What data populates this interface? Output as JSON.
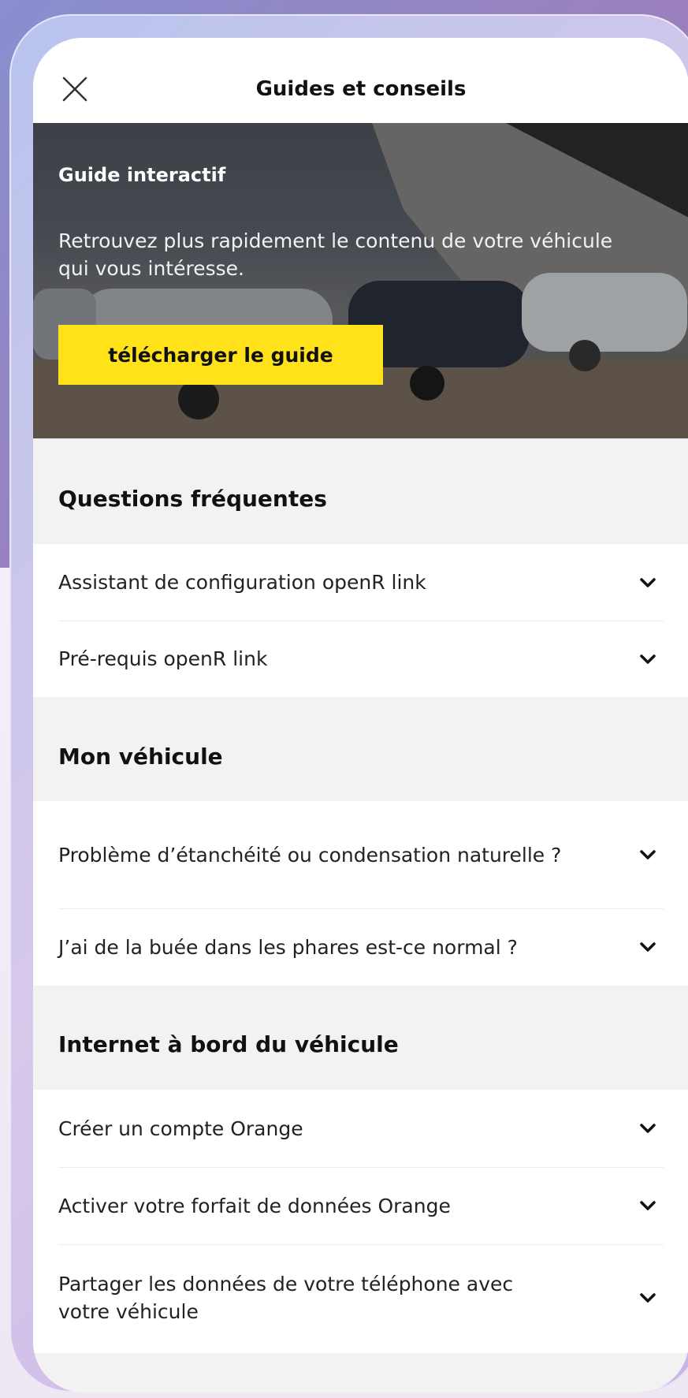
{
  "header": {
    "title": "Guides et conseils"
  },
  "hero": {
    "title": "Guide interactif",
    "description": "Retrouvez plus rapidement le contenu de votre véhicule qui vous intéresse.",
    "button_label": "télécharger le guide"
  },
  "sections": [
    {
      "title": "Questions fréquentes",
      "items": [
        {
          "label": "Assistant de configuration openR link"
        },
        {
          "label": "Pré-requis openR link"
        }
      ]
    },
    {
      "title": "Mon véhicule",
      "items": [
        {
          "label": "Problème d’étanchéité ou condensation naturelle ?"
        },
        {
          "label": "J’ai de la buée dans les phares est-ce normal ?"
        }
      ]
    },
    {
      "title": "Internet à bord du véhicule",
      "items": [
        {
          "label": "Créer un compte Orange"
        },
        {
          "label": "Activer votre forfait de données Orange"
        },
        {
          "label": "Partager les données de votre téléphone avec votre véhicule"
        }
      ]
    }
  ],
  "colors": {
    "accent": "#ffe21a",
    "text": "#111111",
    "section_bg": "#f2f2f2"
  },
  "icons": {
    "close": "close-icon",
    "expand": "chevron-down-icon"
  }
}
